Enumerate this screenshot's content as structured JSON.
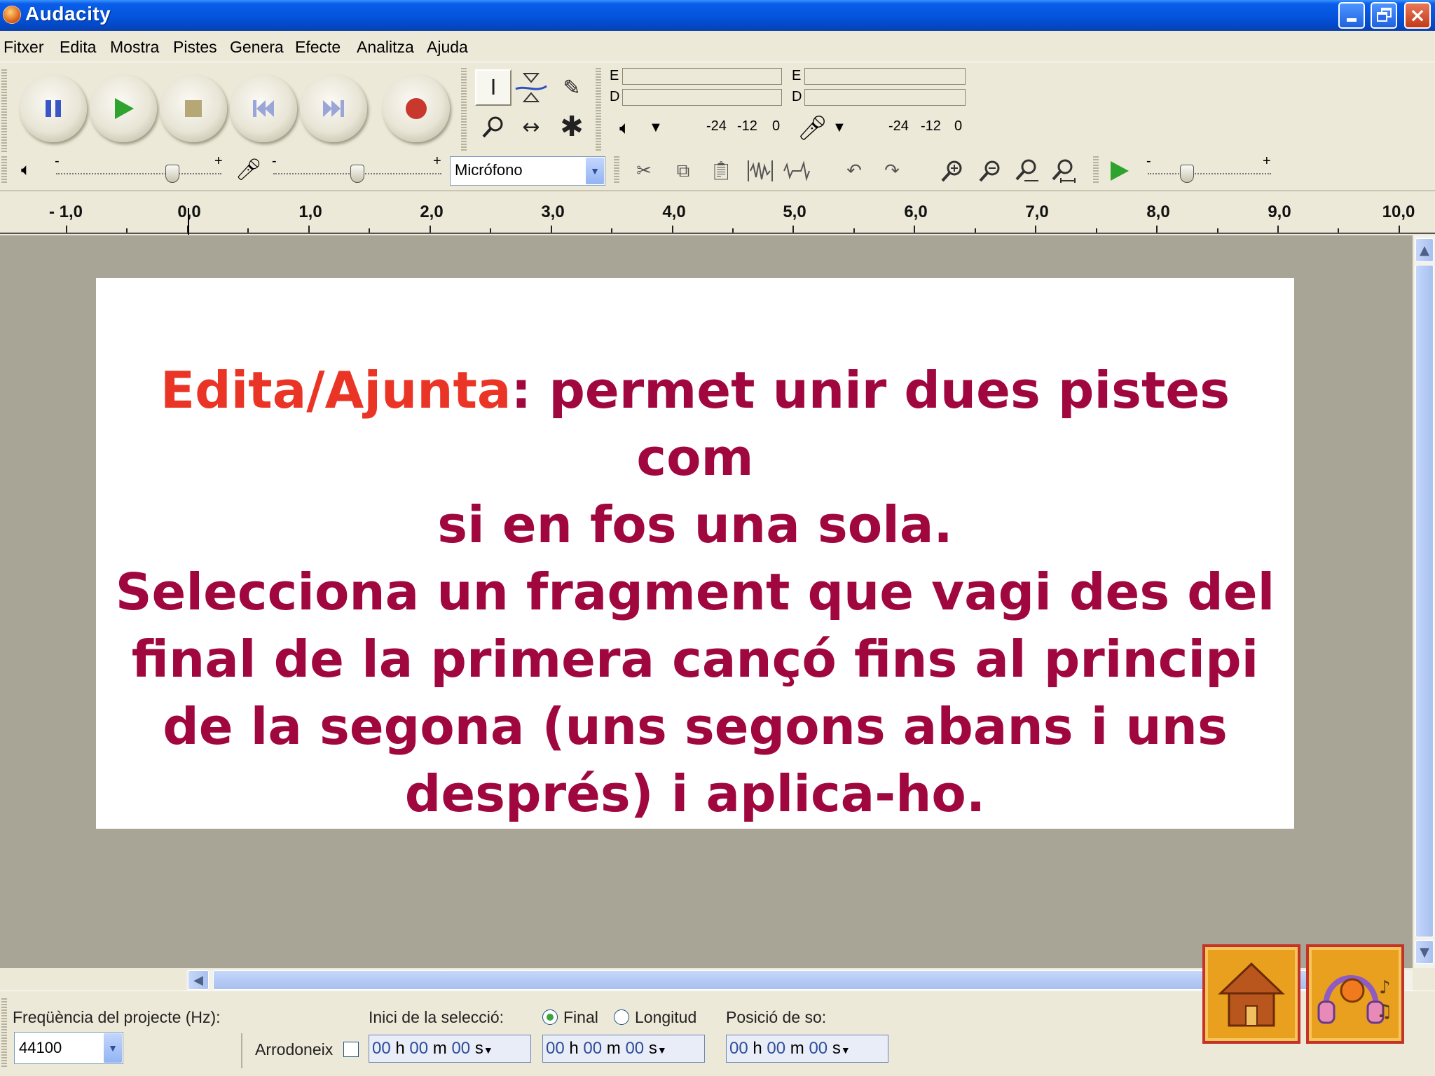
{
  "window": {
    "title": "Audacity",
    "controls": [
      "minimize",
      "maximize",
      "close"
    ]
  },
  "menu": [
    "Fitxer",
    "Edita",
    "Mostra",
    "Pistes",
    "Genera",
    "Efecte",
    "Analitza",
    "Ajuda"
  ],
  "transport": {
    "buttons": [
      "pause",
      "play",
      "stop",
      "skip-to-start",
      "skip-to-end",
      "record"
    ],
    "colors": {
      "pause": "#3a55c8",
      "play": "#2ea32e",
      "stop": "#b5a776",
      "skip": "#9aa5d8",
      "record": "#c8382d"
    }
  },
  "meters": {
    "playback": {
      "top_label": "E",
      "bottom_label": "D",
      "scale": [
        "-24",
        "-12",
        "0"
      ]
    },
    "record": {
      "top_label": "E",
      "bottom_label": "D",
      "scale": [
        "-24",
        "-12",
        "0"
      ]
    }
  },
  "mixer": {
    "input_source": "Micrófono",
    "minus": "-",
    "plus": "+",
    "output_volume_level": 0.72,
    "input_volume_level": 0.5,
    "play_at_speed_level": 0.3
  },
  "ruler": {
    "labels": [
      "- 1,0",
      "0,0",
      "1,0",
      "2,0",
      "3,0",
      "4,0",
      "5,0",
      "6,0",
      "7,0",
      "8,0",
      "9,0",
      "10,0"
    ]
  },
  "slide": {
    "term": "Edita/Ajunta",
    "line1_rest": ": permet unir dues pistes com",
    "line2": "si en fos una sola.",
    "line3": "Selecciona un fragment que vagi des del",
    "line4": "final de la primera cançó fins al principi",
    "line5": "de la segona (uns segons abans i uns",
    "line6": "després) i aplica-ho.",
    "term_color": "#ea3526",
    "text_color": "#a0073f"
  },
  "status": {
    "project_rate_label": "Freqüència del projecte (Hz):",
    "project_rate_value": "44100",
    "snap_label": "Arrodoneix",
    "selection_start_label": "Inici de la selecció:",
    "radio_end_label": "Final",
    "radio_length_label": "Longitud",
    "audio_position_label": "Posició de so:",
    "time_h": "00",
    "time_m": "00",
    "time_s": "00",
    "unit_h": "h",
    "unit_m": "m",
    "unit_s": "s"
  },
  "nav": {
    "home_icon": "house-icon",
    "media_icon": "headphones-music-icon"
  }
}
